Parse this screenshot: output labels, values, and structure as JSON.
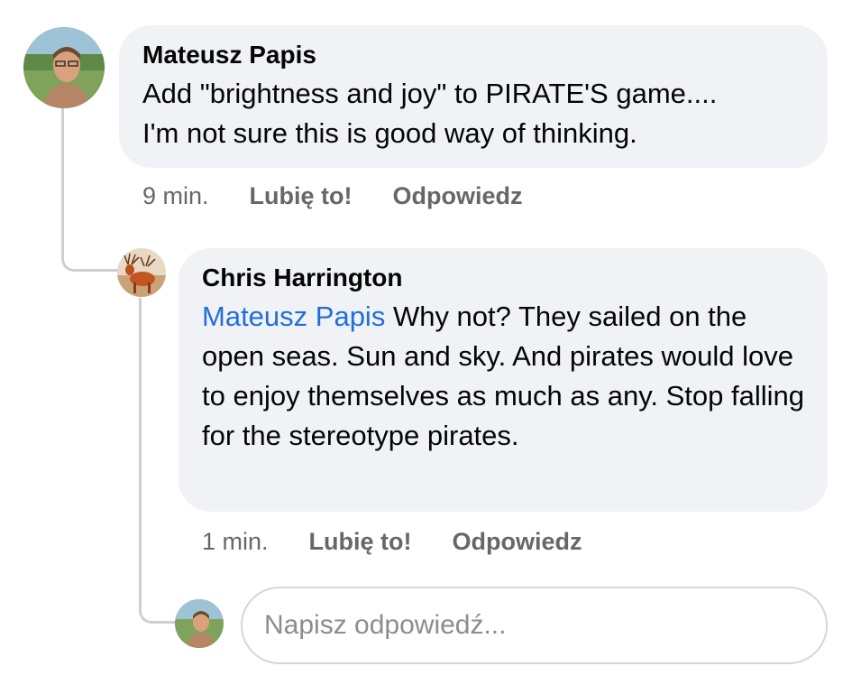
{
  "comment": {
    "author": "Mateusz Papis",
    "text_line1": "Add \"brightness and joy\" to PIRATE'S game....",
    "text_line2": "I'm not sure this is good way of thinking.",
    "time": "9 min.",
    "like_label": "Lubię to!",
    "reply_label": "Odpowiedz"
  },
  "reply": {
    "author": "Chris Harrington",
    "mention": "Mateusz Papis",
    "text": " Why not? They sailed on the open seas. Sun and sky. And pirates would love to enjoy themselves as much as any. Stop falling for the stereotype pirates.",
    "time": "1 min.",
    "like_label": "Lubię to!",
    "reply_label": "Odpowiedz"
  },
  "composer": {
    "placeholder": "Napisz odpowiedź..."
  },
  "colors": {
    "bubble": "#f0f2f5",
    "mention": "#216fdb",
    "meta_text": "#65676b",
    "thread_line": "#ccd0d5"
  },
  "icons": {
    "mateusz_avatar": "profile-photo-man-outdoors",
    "chris_avatar": "profile-photo-deer",
    "current_user_avatar": "profile-photo-man-outdoors"
  }
}
